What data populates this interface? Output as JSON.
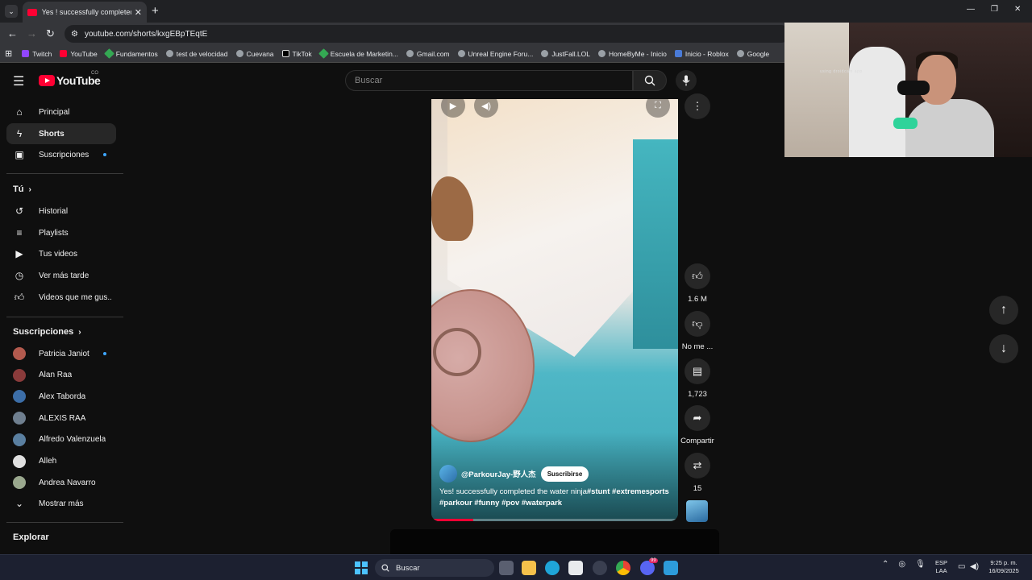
{
  "browser": {
    "tab_title": "Yes ! successfully completed th",
    "url": "youtube.com/shorts/kxgEBpTEqtE",
    "bookmarks": [
      "Twitch",
      "YouTube",
      "Fundamentos",
      "test de velocidad",
      "Cuevana",
      "TikTok",
      "Escuela de Marketin...",
      "Gmail.com",
      "Unreal Engine Foru...",
      "JustFall.LOL",
      "HomeByMe - Inicio",
      "Inicio - Roblox",
      "Google"
    ]
  },
  "header": {
    "logo_text": "YouTube",
    "country_code": "CO",
    "search_placeholder": "Buscar"
  },
  "sidebar": {
    "main": [
      {
        "label": "Principal",
        "icon": "home-icon"
      },
      {
        "label": "Shorts",
        "icon": "shorts-icon"
      },
      {
        "label": "Suscripciones",
        "icon": "subscriptions-icon"
      }
    ],
    "you_title": "Tú",
    "you_items": [
      {
        "label": "Historial",
        "icon": "history-icon"
      },
      {
        "label": "Playlists",
        "icon": "playlists-icon"
      },
      {
        "label": "Tus videos",
        "icon": "your-videos-icon"
      },
      {
        "label": "Ver más tarde",
        "icon": "watch-later-icon"
      },
      {
        "label": "Videos que me gus...",
        "icon": "liked-icon"
      }
    ],
    "subs_title": "Suscripciones",
    "subscriptions": [
      {
        "label": "Patricia Janiot",
        "color": "#b35a4e"
      },
      {
        "label": "Alan Raa",
        "color": "#8a3b3b"
      },
      {
        "label": "Alex Taborda",
        "color": "#3c6ea8"
      },
      {
        "label": "ALEXIS RAA",
        "color": "#6f7f8f"
      },
      {
        "label": "Alfredo Valenzuela",
        "color": "#5a7fa0"
      },
      {
        "label": "Alleh",
        "color": "#e0e0e0"
      },
      {
        "label": "Andrea Navarro",
        "color": "#9aa88e"
      }
    ],
    "show_more": "Mostrar más",
    "explore_title": "Explorar"
  },
  "short": {
    "channel": "@ParkourJay-野人杰",
    "subscribe_label": "Suscribirse",
    "caption_text": "Yes!  successfully completed the water ninja",
    "caption_tags_1": "#stunt #extremesports",
    "caption_tags_2": "#parkour #funny #pov #waterpark",
    "progress": 0.17
  },
  "actions": {
    "likes": "1.6 M",
    "dislike": "No me ...",
    "comments": "1,723",
    "share": "Compartir",
    "remix": "15"
  },
  "webcam_caption": "using droidcam app",
  "taskbar": {
    "search_label": "Buscar",
    "lang_1": "ESP",
    "lang_2": "LAA",
    "time": "9:25 p. m.",
    "date": "16/09/2025",
    "discord_badge": "99"
  }
}
